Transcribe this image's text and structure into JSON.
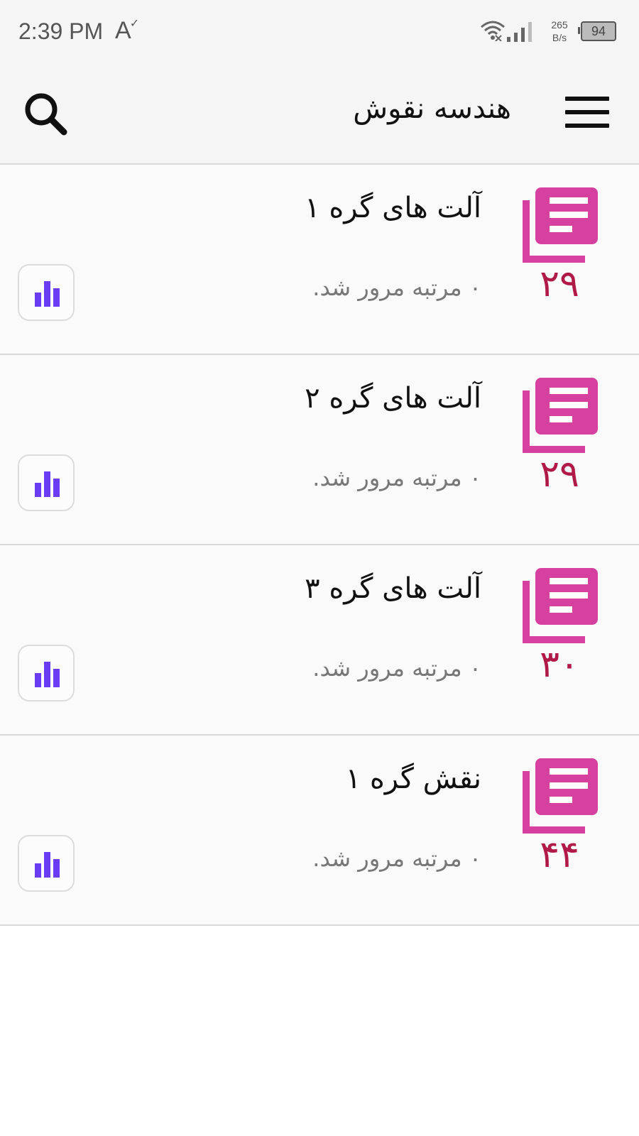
{
  "status_bar": {
    "time": "2:39 PM",
    "font_indicator": "A",
    "net_speed_value": "265",
    "net_speed_unit": "B/s",
    "battery": "94"
  },
  "app_bar": {
    "title": "هندسه نقوش",
    "search_icon": "search-icon",
    "menu_icon": "hamburger-menu-icon"
  },
  "colors": {
    "icon_pink": "#d6409f",
    "count_red": "#b01a48",
    "stats_purple": "#6a3cf5"
  },
  "list": {
    "items": [
      {
        "title": "آلت های گره ۱",
        "subtitle": "۰ مرتبه مرور شد.",
        "count": "۲۹"
      },
      {
        "title": "آلت های گره ۲",
        "subtitle": "۰ مرتبه مرور شد.",
        "count": "۲۹"
      },
      {
        "title": "آلت های گره ۳",
        "subtitle": "۰ مرتبه مرور شد.",
        "count": "۳۰"
      },
      {
        "title": "نقش گره ۱",
        "subtitle": "۰ مرتبه مرور شد.",
        "count": "۴۴"
      }
    ]
  }
}
